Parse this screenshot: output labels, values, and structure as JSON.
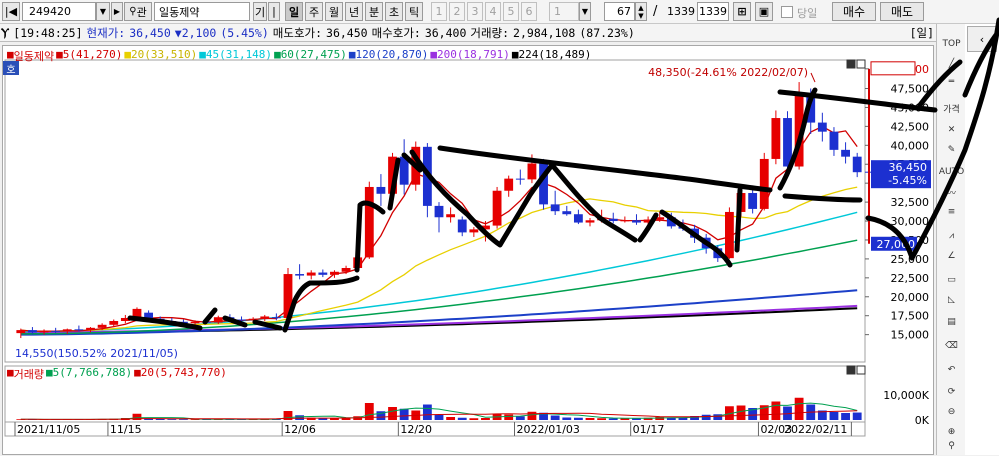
{
  "toolbar": {
    "stock_code": "249420",
    "search_icon": "search-icon",
    "gwan_label": "관",
    "stock_name": "일동제약",
    "gi_label": "기",
    "periods": [
      "일",
      "주",
      "월",
      "년",
      "분",
      "초",
      "틱"
    ],
    "active_period": "일",
    "num_buttons": [
      "1",
      "2",
      "3",
      "4",
      "5",
      "6"
    ],
    "num_select": "1",
    "count_value": "67",
    "slash": "/",
    "total_a": "1339",
    "total_b": "1339",
    "today_label": "당일",
    "buy_button": "매수",
    "sell_button": "매도"
  },
  "infobar": {
    "time": "[19:48:25]",
    "price_label": "현재가:",
    "price_value": "36,450",
    "change_arrow": "▼",
    "change_value": "2,100",
    "change_pct": "(5.45%)",
    "ask_label": "매도호가:",
    "ask_value": "36,450",
    "bid_label": "매수호가:",
    "bid_value": "36,400",
    "volume_label": "거래량:",
    "volume_value": "2,984,108",
    "volume_pct": "(87.23%)",
    "right_tag": "[일]"
  },
  "price_legend": [
    {
      "text": "일동제약",
      "color": "#d20000",
      "marker": "■"
    },
    {
      "text": "5(41,270)",
      "color": "#d20000",
      "marker": "■"
    },
    {
      "text": "20(33,510)",
      "color": "#e8d000",
      "marker": "■"
    },
    {
      "text": "45(31,148)",
      "color": "#00c8d8",
      "marker": "■"
    },
    {
      "text": "60(27,475)",
      "color": "#00a050",
      "marker": "■"
    },
    {
      "text": "120(20,870)",
      "color": "#1c40c8",
      "marker": "■"
    },
    {
      "text": "200(18,791)",
      "color": "#9a30e0",
      "marker": "■"
    },
    {
      "text": "224(18,489)",
      "color": "#000000",
      "marker": "■"
    }
  ],
  "volume_legend": [
    {
      "text": "거래량",
      "color": "#d20000",
      "marker": "■"
    },
    {
      "text": "5(7,766,788)",
      "color": "#00a050",
      "marker": "■"
    },
    {
      "text": "20(5,743,770)",
      "color": "#d20000",
      "marker": "■"
    }
  ],
  "ho_label": "호",
  "annotations": {
    "high": "48,350(-24.61% 2022/02/07)",
    "low": "14,550(150.52% 2021/11/05)",
    "price_tag_high": "50,100",
    "current_price_tag": "36,450",
    "current_pct_tag": "-5.45%",
    "low_tag": "27,000"
  },
  "chart_data": [
    {
      "type": "candlestick",
      "title": "일동제약",
      "y_axis_labels": [
        "50,100",
        "47,500",
        "45,000",
        "42,500",
        "40,000",
        "37,500",
        "35,000",
        "32,500",
        "30,000",
        "27,500",
        "25,000",
        "22,500",
        "20,000",
        "17,500",
        "15,000"
      ],
      "x_axis_labels": [
        "2021/11/05",
        "11/15",
        "12/06",
        "12/20",
        "2022/01/03",
        "01/17",
        "02/03",
        "2022/02/11"
      ],
      "ylim": [
        13500,
        51000
      ],
      "candles": [
        [
          15200,
          15800,
          14550,
          15600
        ],
        [
          15600,
          16000,
          15100,
          15300
        ],
        [
          15300,
          15700,
          15000,
          15500
        ],
        [
          15500,
          15900,
          15200,
          15400
        ],
        [
          15400,
          15800,
          15100,
          15700
        ],
        [
          15700,
          16200,
          15400,
          15600
        ],
        [
          15600,
          16000,
          15300,
          15900
        ],
        [
          15900,
          16500,
          15600,
          16300
        ],
        [
          16300,
          17000,
          16000,
          16800
        ],
        [
          16800,
          17600,
          16500,
          17200
        ],
        [
          17000,
          18600,
          16800,
          18400
        ],
        [
          17900,
          18200,
          17000,
          17100
        ],
        [
          17100,
          17400,
          16600,
          16800
        ],
        [
          16800,
          17200,
          16400,
          16700
        ],
        [
          16700,
          17000,
          16200,
          16500
        ],
        [
          16500,
          16900,
          16100,
          16700
        ],
        [
          16700,
          17100,
          16400,
          16600
        ],
        [
          16600,
          17500,
          16400,
          17300
        ],
        [
          17300,
          17700,
          16800,
          17000
        ],
        [
          17000,
          17400,
          16600,
          16900
        ],
        [
          16900,
          17300,
          16500,
          17100
        ],
        [
          17100,
          17600,
          16800,
          17400
        ],
        [
          17300,
          17800,
          16900,
          17200
        ],
        [
          17200,
          23800,
          17100,
          23000
        ],
        [
          23000,
          24300,
          22300,
          22800
        ],
        [
          22800,
          23500,
          22300,
          23200
        ],
        [
          23200,
          23600,
          22600,
          22900
        ],
        [
          22900,
          23500,
          22500,
          23300
        ],
        [
          23300,
          24100,
          23000,
          23800
        ],
        [
          23800,
          25500,
          23500,
          25200
        ],
        [
          25200,
          35200,
          25000,
          34500
        ],
        [
          34500,
          36200,
          32000,
          33600
        ],
        [
          33600,
          39000,
          33000,
          38500
        ],
        [
          38500,
          40800,
          33500,
          34800
        ],
        [
          34800,
          40500,
          34000,
          39800
        ],
        [
          39800,
          40300,
          30500,
          32000
        ],
        [
          32000,
          32500,
          28500,
          30500
        ],
        [
          30500,
          31800,
          29800,
          30900
        ],
        [
          30200,
          30600,
          28000,
          28500
        ],
        [
          28500,
          29200,
          27900,
          28900
        ],
        [
          28900,
          30000,
          27300,
          29400
        ],
        [
          29400,
          34500,
          29000,
          34000
        ],
        [
          34000,
          36000,
          33200,
          35600
        ],
        [
          35600,
          36800,
          34800,
          35500
        ],
        [
          35500,
          38800,
          35000,
          37600
        ],
        [
          37600,
          38200,
          31500,
          32200
        ],
        [
          32200,
          34000,
          30800,
          31300
        ],
        [
          31300,
          32000,
          30700,
          30900
        ],
        [
          30900,
          31500,
          29600,
          29800
        ],
        [
          29800,
          30400,
          29300,
          30100
        ],
        [
          30100,
          31500,
          29800,
          30300
        ],
        [
          30300,
          31100,
          29700,
          30000
        ],
        [
          30000,
          30600,
          29800,
          30100
        ],
        [
          30100,
          30900,
          29500,
          29800
        ],
        [
          29800,
          30600,
          29000,
          30200
        ],
        [
          30200,
          31200,
          29900,
          30500
        ],
        [
          30500,
          31100,
          29000,
          29300
        ],
        [
          29300,
          30200,
          28700,
          29000
        ],
        [
          29000,
          29500,
          27100,
          27800
        ],
        [
          27800,
          28300,
          25700,
          26400
        ],
        [
          26400,
          26800,
          24600,
          25100
        ],
        [
          25100,
          31800,
          25000,
          31200
        ],
        [
          31200,
          34500,
          30600,
          33700
        ],
        [
          33700,
          34700,
          31000,
          31600
        ],
        [
          31600,
          39000,
          31400,
          38200
        ],
        [
          38200,
          44600,
          37500,
          43600
        ],
        [
          43600,
          44500,
          36000,
          37200
        ],
        [
          37200,
          48350,
          36800,
          46800
        ],
        [
          46800,
          47500,
          41500,
          43000
        ],
        [
          43000,
          44300,
          40500,
          41800
        ],
        [
          41800,
          42400,
          38600,
          39400
        ],
        [
          39400,
          40400,
          37600,
          38500
        ],
        [
          38500,
          39000,
          35800,
          36450
        ]
      ],
      "ma5_end": 41270,
      "ma20_end": 33510,
      "ma45_end": 31148,
      "ma60_end": 27475,
      "ma120_end": 20870,
      "ma200_end": 18791,
      "ma224_end": 18489
    },
    {
      "type": "bar",
      "title": "거래량",
      "y_axis_labels": [
        "10,000K",
        "0K"
      ],
      "volumes_k": [
        300,
        250,
        220,
        260,
        240,
        280,
        260,
        400,
        500,
        800,
        2500,
        700,
        400,
        300,
        280,
        250,
        260,
        350,
        300,
        270,
        260,
        280,
        320,
        3600,
        1900,
        900,
        700,
        600,
        800,
        1500,
        6800,
        3500,
        5200,
        4500,
        3800,
        6200,
        2000,
        1200,
        900,
        700,
        800,
        2600,
        2200,
        1500,
        3300,
        2900,
        1800,
        1000,
        900,
        800,
        700,
        600,
        650,
        700,
        900,
        1200,
        1000,
        900,
        1600,
        2100,
        2300,
        5500,
        5800,
        4800,
        5900,
        7400,
        5400,
        8900,
        6200,
        3800,
        3200,
        2800,
        2984
      ],
      "ylim": [
        0,
        16000
      ]
    }
  ]
}
